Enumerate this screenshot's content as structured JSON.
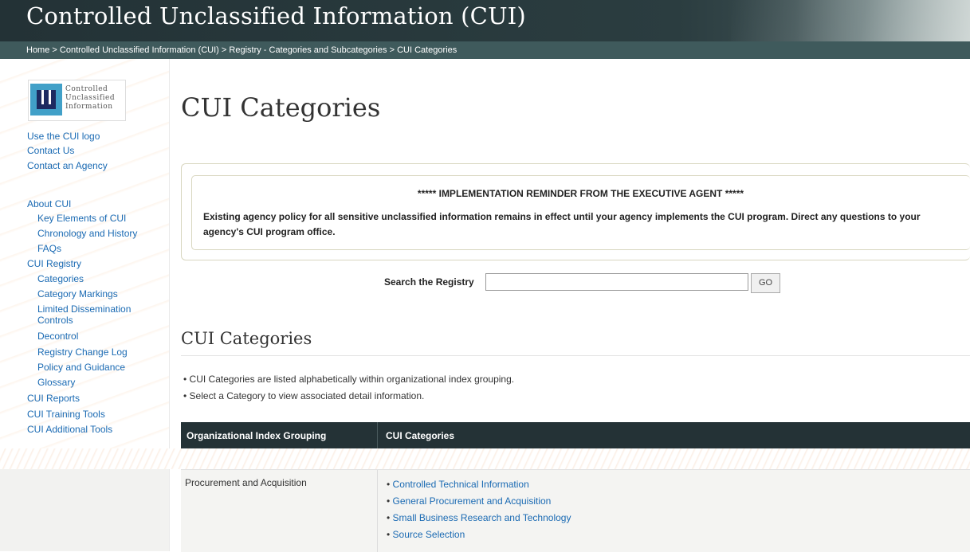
{
  "header": {
    "title": "Controlled Unclassified Information (CUI)"
  },
  "breadcrumb": {
    "home": "Home",
    "sep": ">",
    "crumbs": [
      "Controlled Unclassified Information (CUI)",
      "Registry - Categories and Subcategories",
      "CUI Categories"
    ]
  },
  "logo": {
    "line1": "Controlled",
    "line2": "Unclassified",
    "line3": "Information"
  },
  "sidebar": {
    "top_links": [
      "Use the CUI logo",
      "Contact Us",
      "Contact an Agency"
    ],
    "about": "About CUI",
    "about_items": [
      "Key Elements of CUI",
      "Chronology and History",
      "FAQs"
    ],
    "registry": "CUI Registry",
    "registry_items": [
      "Categories",
      "Category Markings",
      "Limited Dissemination Controls",
      "Decontrol",
      "Registry Change Log",
      "Policy and Guidance",
      "Glossary"
    ],
    "bottom_links": [
      "CUI Reports",
      "CUI Training Tools",
      "CUI Additional Tools"
    ]
  },
  "main": {
    "page_title": "CUI Categories",
    "notice_heading": "***** IMPLEMENTATION REMINDER FROM THE EXECUTIVE AGENT *****",
    "notice_body": "Existing agency policy for all sensitive unclassified information remains in effect until your agency implements the CUI program. Direct any questions to your agency's CUI program office.",
    "search_label": "Search the Registry",
    "search_value": "",
    "search_button": "GO",
    "section_title": "CUI Categories",
    "bullets": [
      "CUI Categories are listed alphabetically within organizational index grouping.",
      "Select a Category to view associated detail information."
    ]
  },
  "table": {
    "col1": "Organizational Index Grouping",
    "col2": "CUI Categories",
    "rows": [
      {
        "group": "Procurement and Acquisition",
        "categories": [
          "Controlled Technical Information",
          "General Procurement and Acquisition",
          "Small Business Research and Technology",
          "Source Selection"
        ]
      }
    ]
  },
  "colors": {
    "header_bg": "#233236",
    "breadcrumb_bg": "#3f5a5c",
    "link": "#1a6ab3",
    "table_head_bg": "#243236"
  }
}
